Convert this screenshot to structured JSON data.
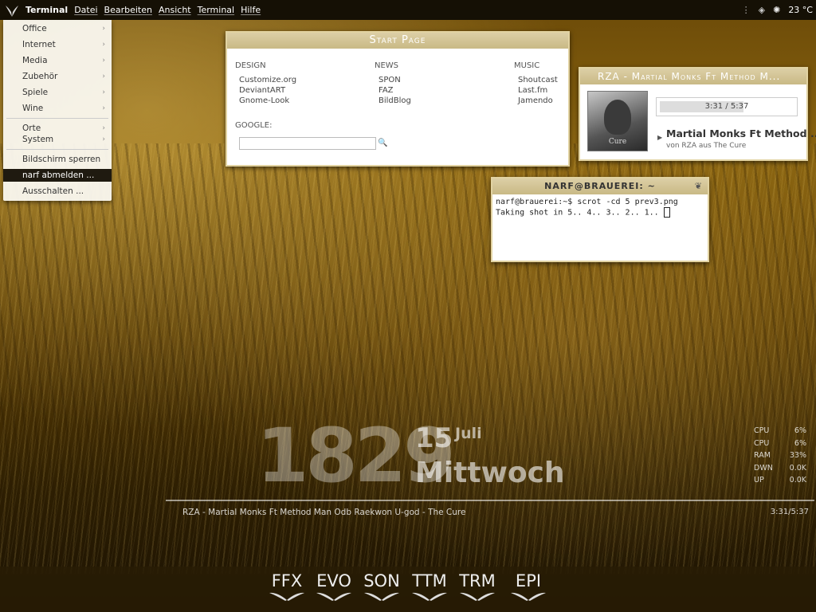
{
  "topbar": {
    "app_name": "Terminal",
    "menus": [
      "Datei",
      "Bearbeiten",
      "Ansicht",
      "Terminal",
      "Hilfe"
    ],
    "temperature": "23 °C"
  },
  "app_menu": {
    "items": [
      {
        "label": "Office",
        "submenu": true
      },
      {
        "label": "Internet",
        "submenu": true
      },
      {
        "label": "Media",
        "submenu": true
      },
      {
        "label": "Zubehör",
        "submenu": true
      },
      {
        "label": "Spiele",
        "submenu": true
      },
      {
        "label": "Wine",
        "submenu": true
      },
      {
        "label": "Orte",
        "submenu": true
      },
      {
        "label": "System",
        "submenu": true
      },
      {
        "label": "Bildschirm sperren",
        "submenu": false
      },
      {
        "label": "narf abmelden ...",
        "submenu": false,
        "highlighted": true
      },
      {
        "label": "Ausschalten ...",
        "submenu": false
      }
    ]
  },
  "start_page": {
    "title": "Start Page",
    "columns": [
      {
        "heading": "DESIGN",
        "links": [
          "Customize.org",
          "DeviantART",
          "Gnome-Look"
        ]
      },
      {
        "heading": "NEWS",
        "links": [
          "SPON",
          "FAZ",
          "BildBlog"
        ]
      },
      {
        "heading": "MUSIC",
        "links": [
          "Shoutcast",
          "Last.fm",
          "Jamendo"
        ]
      }
    ],
    "google_label": "GOOGLE:",
    "google_value": ""
  },
  "player": {
    "title": "RZA - Martial Monks Ft Method M...",
    "progress_text": "3:31 / 5:37",
    "progress_fraction": 0.626,
    "track_title": "Martial Monks Ft Method ...",
    "track_sub": "von RZA aus The Cure",
    "album_text": "Cure"
  },
  "terminal": {
    "title": "narf@brauerei: ~",
    "line1": "narf@brauerei:~$ scrot -cd 5 prev3.png",
    "line2": "Taking shot in 5.. 4.. 3.. 2.. 1.. "
  },
  "clock": {
    "time": "1829",
    "day": "15",
    "month": "Juli",
    "weekday": "Mittwoch"
  },
  "now_playing": {
    "text": "RZA - Martial Monks Ft Method Man Odb Raekwon U-god - The Cure",
    "time": "3:31/5:37"
  },
  "stats": [
    {
      "label": "CPU",
      "value": "6%"
    },
    {
      "label": "CPU",
      "value": "6%"
    },
    {
      "label": "RAM",
      "value": "33%"
    },
    {
      "label": "DWN",
      "value": "0.0K"
    },
    {
      "label": "UP",
      "value": "0.0K"
    }
  ],
  "dock": [
    "FFX",
    "EVO",
    "SON",
    "TTM",
    "TRM",
    "EPI"
  ]
}
